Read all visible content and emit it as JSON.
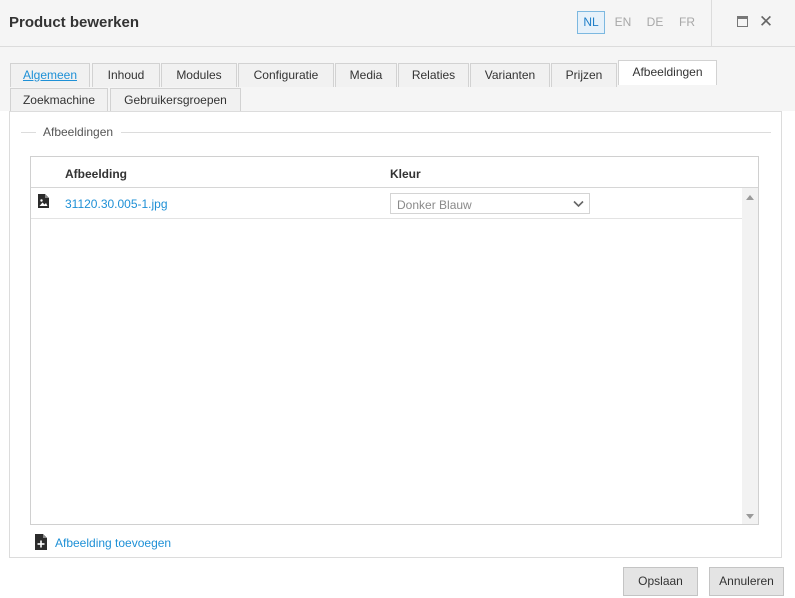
{
  "window": {
    "title": "Product bewerken",
    "languages": [
      {
        "code": "NL",
        "active": true
      },
      {
        "code": "EN",
        "active": false
      },
      {
        "code": "DE",
        "active": false
      },
      {
        "code": "FR",
        "active": false
      }
    ],
    "maximize_icon": "maximize-icon",
    "close_icon": "close-icon",
    "close_glyph": "✕"
  },
  "tabs": {
    "row1": [
      {
        "label": "Algemeen",
        "state": "link"
      },
      {
        "label": "Inhoud"
      },
      {
        "label": "Modules"
      },
      {
        "label": "Configuratie"
      },
      {
        "label": "Media"
      },
      {
        "label": "Relaties"
      },
      {
        "label": "Varianten"
      },
      {
        "label": "Prijzen"
      },
      {
        "label": "Afbeeldingen",
        "state": "active"
      }
    ],
    "row2": [
      {
        "label": "Zoekmachine"
      },
      {
        "label": "Gebruikersgroepen"
      }
    ]
  },
  "section": {
    "legend": "Afbeeldingen",
    "grid": {
      "columns": [
        "Afbeelding",
        "Kleur"
      ],
      "rows": [
        {
          "file": "31120.30.005-1.jpg",
          "color": "Donker Blauw",
          "icon": "image-file-icon"
        }
      ]
    },
    "add_label": "Afbeelding toevoegen",
    "add_icon": "add-file-icon"
  },
  "footer": {
    "save_label": "Opslaan",
    "cancel_label": "Annuleren"
  },
  "colors": {
    "accent": "#1e90d6",
    "active_lang_border": "#7cb8e0",
    "header_bg": "#f5f5f5"
  }
}
